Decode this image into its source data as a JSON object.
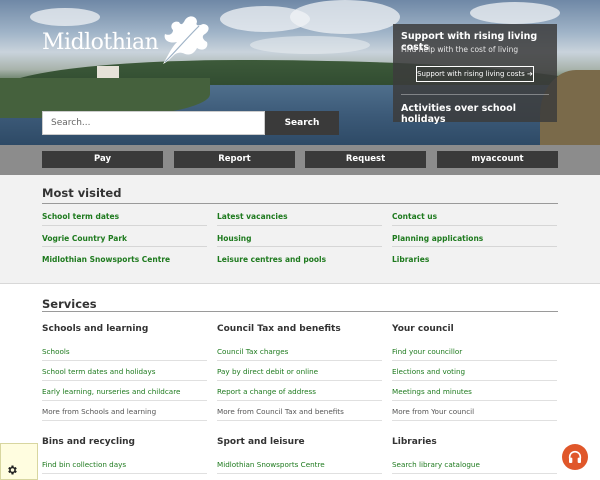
{
  "site": {
    "logo_text": "Midlothian"
  },
  "search": {
    "placeholder": "Search...",
    "button_label": "Search"
  },
  "promo": {
    "title": "Support with rising living costs",
    "subtitle": "Find help with the cost of living",
    "button_label": "Support with rising living costs ➔",
    "title2": "Activities over school holidays"
  },
  "actions": [
    {
      "label": "Pay"
    },
    {
      "label": "Report"
    },
    {
      "label": "Request"
    },
    {
      "label": "myaccount"
    }
  ],
  "most_visited": {
    "title": "Most visited",
    "columns": [
      [
        "School term dates",
        "Vogrie Country Park",
        "Midlothian Snowsports Centre"
      ],
      [
        "Latest vacancies",
        "Housing",
        "Leisure centres and pools"
      ],
      [
        "Contact us",
        "Planning applications",
        "Libraries"
      ]
    ]
  },
  "services": {
    "title": "Services",
    "categories": [
      {
        "title": "Schools and learning",
        "links": [
          "Schools",
          "School term dates and holidays",
          "Early learning, nurseries and childcare"
        ],
        "more": "More from Schools and learning"
      },
      {
        "title": "Council Tax and benefits",
        "links": [
          "Council Tax charges",
          "Pay by direct debit or online",
          "Report a change of address"
        ],
        "more": "More from Council Tax and benefits"
      },
      {
        "title": "Your council",
        "links": [
          "Find your councillor",
          "Elections and voting",
          "Meetings and minutes"
        ],
        "more": "More from Your council"
      },
      {
        "title": "Bins and recycling",
        "links": [
          "Find bin collection days"
        ]
      },
      {
        "title": "Sport and leisure",
        "links": [
          "Midlothian Snowsports Centre"
        ]
      },
      {
        "title": "Libraries",
        "links": [
          "Search library catalogue"
        ]
      }
    ]
  },
  "icons": {
    "cookie_settings": "gear-icon",
    "accessibility_audio": "headphones-icon"
  },
  "colors": {
    "link_green": "#1e7a1e",
    "button_dark": "#3a3a3a",
    "action_bar": "#8c8c8c",
    "headphones_bg": "#e0572a"
  }
}
